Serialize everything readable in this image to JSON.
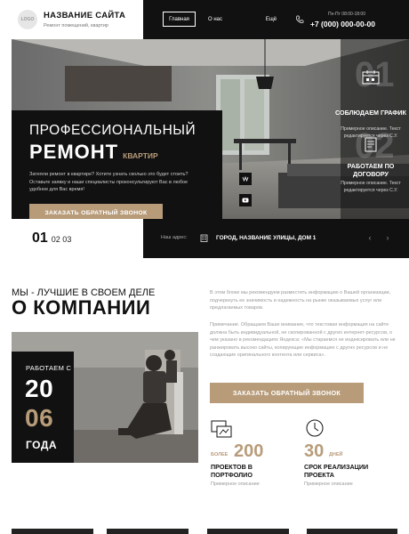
{
  "header": {
    "logo_text": "LOGO",
    "site_title": "НАЗВАНИЕ САЙТА",
    "site_subtitle": "Ремонт помещений, квартир",
    "nav": [
      {
        "label": "Главная"
      },
      {
        "label": "О нас"
      },
      {
        "label": "Ещё"
      }
    ],
    "hours": "Пн-Пт 08:00-18:00",
    "phone": "+7 (000) 000-00-00"
  },
  "hero": {
    "title_line1": "ПРОФЕССИОНАЛЬНЫЙ",
    "title_big": "РЕМОНТ",
    "title_small": "КВАРТИР",
    "text": "Затеяли ремонт в квартире? Хотите узнать сколько это будет стоить? Оставьте заявку и наши специалисты проконсультируют Вас в любое удобное для Вас время!",
    "button": "ЗАКАЗАТЬ ОБРАТНЫЙ ЗВОНОК",
    "features": [
      {
        "num": "01",
        "icon": "calendar-icon",
        "title": "СОБЛЮДАЕМ ГРАФИК",
        "text": "Примерное описание. Текст редактируется через С.У."
      },
      {
        "num": "02",
        "icon": "contract-icon",
        "title": "РАБОТАЕМ ПО ДОГОВОРУ",
        "text": "Примерное описание. Текст редактируется через С.У."
      }
    ],
    "side_icons": [
      "vk-icon",
      "youtube-icon"
    ]
  },
  "slider": {
    "current": "01",
    "others": "02  03",
    "address_label": "Наш адрес:",
    "address": "ГОРОД, НАЗВАНИЕ УЛИЦЫ, ДОМ 1"
  },
  "about": {
    "pre": "МЫ - ЛУЧШИЕ В СВОЕМ ДЕЛЕ",
    "title": "О КОМПАНИИ",
    "p1": "В этом блоке мы рекомендуем разместить информацию о Вашей организации, подчеркнуть ее значимость и надежность на рынке оказываемых услуг или предлагаемых товаров.",
    "p2": "Примечание. Обращаем Ваше внимание, что текстовая информация на сайте должна быть индивидуальной, не скопированной с других интернет-ресурсов, о чем указано в рекомендациях Яндекса: «Мы стараемся не индексировать или не ранжировать высоко сайты, копирующие информацию с других ресурсов и не создающие оригинального контента или сервиса».",
    "years_label": "РАБОТАЕМ С",
    "years_top": "20",
    "years_bottom": "06",
    "years_word": "ГОДА",
    "button": "ЗАКАЗАТЬ ОБРАТНЫЙ ЗВОНОК",
    "stats": [
      {
        "icon": "portfolio-icon",
        "pre": "БОЛЕЕ",
        "num": "200",
        "unit": "",
        "title": "ПРОЕКТОВ В ПОРТФОЛИО",
        "desc": "Примерное описание"
      },
      {
        "icon": "clock-icon",
        "pre": "",
        "num": "30",
        "unit": "ДНЕЙ",
        "title": "СРОК РЕАЛИЗАЦИИ ПРОЕКТА",
        "desc": "Примерное описание"
      }
    ]
  },
  "colors": {
    "accent": "#b89c7a",
    "dark": "#111111"
  }
}
